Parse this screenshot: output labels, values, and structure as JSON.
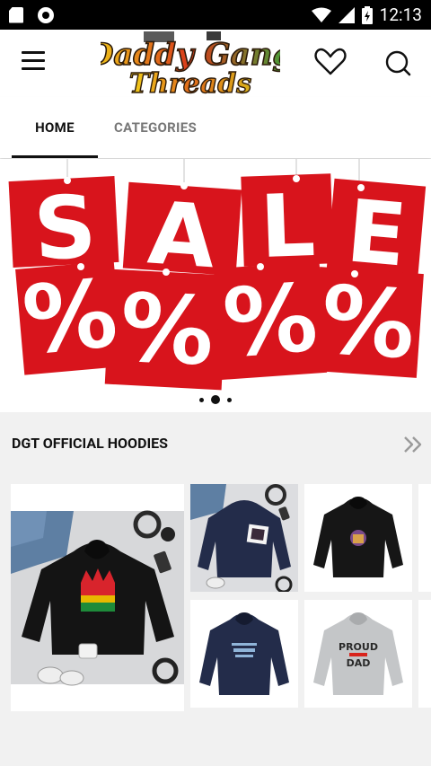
{
  "status_bar": {
    "time": "12:13",
    "icons": [
      "sd-card-icon",
      "record-icon",
      "wifi-icon",
      "signal-icon",
      "battery-icon"
    ]
  },
  "app_bar": {
    "logo_line1": "Daddy Gang",
    "logo_line2": "Threads",
    "icons": [
      "menu-icon",
      "heart-icon",
      "search-icon"
    ]
  },
  "tabs": [
    {
      "label": "HOME",
      "active": true
    },
    {
      "label": "CATEGORIES",
      "active": false
    }
  ],
  "banner": {
    "letters": [
      "S",
      "A",
      "L",
      "E"
    ],
    "symbols": [
      "%",
      "%",
      "%",
      "%"
    ],
    "slide_count": 3,
    "active_slide": 2
  },
  "section": {
    "title": "DGT OFFICIAL HOODIES",
    "more_icon": "double-chevron-right-icon"
  },
  "products": [
    {
      "name": "black-hoodie-crown-flatlay"
    },
    {
      "name": "navy-hoodie-flatlay"
    },
    {
      "name": "black-hoodie-print"
    },
    {
      "name": "navy-hoodie-special-daddy"
    },
    {
      "name": "grey-hoodie-proud-dad",
      "print_line1": "PROUD",
      "print_line2": "DAD"
    }
  ],
  "colors": {
    "sale_red": "#d8141c",
    "navy": "#232c4a",
    "heather_grey": "#c4c6c8",
    "background": "#f1f1f1"
  }
}
